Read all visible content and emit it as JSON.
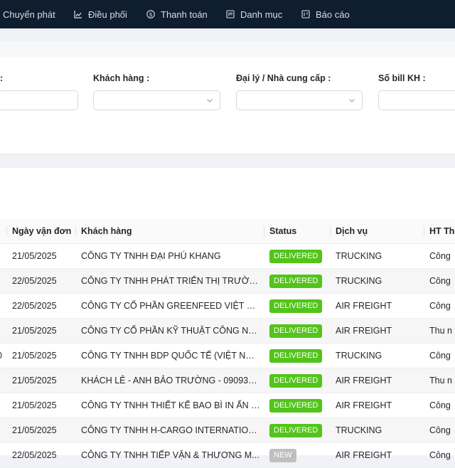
{
  "colors": {
    "topbar": "#0f1e2e",
    "delivered": "#52c41a",
    "new": "#bfbfbf"
  },
  "nav": {
    "items": [
      {
        "label": "Chuyển phát",
        "icon": "none"
      },
      {
        "label": "Điều phối",
        "icon": "chart-icon"
      },
      {
        "label": "Thanh toán",
        "icon": "dollar-circle-icon"
      },
      {
        "label": "Danh mục",
        "icon": "catalog-icon"
      },
      {
        "label": "Báo cáo",
        "icon": "report-icon"
      }
    ]
  },
  "filters": {
    "first_label_suffix": ":",
    "customer_label": "Khách hàng :",
    "agent_label": "Đại lý / Nhà cung cấp :",
    "bill_label": "Số bill KH :"
  },
  "table": {
    "columns": [
      "Ngày vận đơn",
      "Khách hàng",
      "Status",
      "Dịch vụ",
      "HT Th"
    ],
    "rows": [
      {
        "lead": "",
        "date": "21/05/2025",
        "customer": "CÔNG TY TNHH ĐẠI PHÚ KHANG",
        "status": "DELIVERED",
        "service": "TRUCKING",
        "ht": "Công"
      },
      {
        "lead": "",
        "date": "22/05/2025",
        "customer": "CÔNG TY TNHH PHÁT TRIỂN THỊ TRƯỜN...",
        "status": "DELIVERED",
        "service": "TRUCKING",
        "ht": "Công"
      },
      {
        "lead": "",
        "date": "22/05/2025",
        "customer": "CÔNG TY CỔ PHẦN GREENFEED VIỆT NAM",
        "status": "DELIVERED",
        "service": "AIR FREIGHT",
        "ht": "Công"
      },
      {
        "lead": "",
        "date": "21/05/2025",
        "customer": "CÔNG TY CỔ PHẦN KỸ THUẬT CÔNG NG...",
        "status": "DELIVERED",
        "service": "AIR FREIGHT",
        "ht": "Thu n"
      },
      {
        "lead": "0",
        "date": "21/05/2025",
        "customer": "CÔNG TY TNHH BDP QUỐC TẾ (VIỆT NAM)",
        "status": "DELIVERED",
        "service": "TRUCKING",
        "ht": "Công"
      },
      {
        "lead": "",
        "date": "21/05/2025",
        "customer": "KHÁCH LẺ - ANH BẢO TRƯỜNG - 090932...",
        "status": "DELIVERED",
        "service": "AIR FREIGHT",
        "ht": "Thu n"
      },
      {
        "lead": "",
        "date": "21/05/2025",
        "customer": "CÔNG TY TNHH THIẾT KẾ BAO BÌ IN ẤN B...",
        "status": "DELIVERED",
        "service": "AIR FREIGHT",
        "ht": "Công"
      },
      {
        "lead": "",
        "date": "21/05/2025",
        "customer": "CÔNG TY TNHH H-CARGO INTERNATION...",
        "status": "DELIVERED",
        "service": "TRUCKING",
        "ht": "Công"
      },
      {
        "lead": "",
        "date": "22/05/2025",
        "customer": "CÔNG TY TNHH TIẾP VẬN & THƯƠNG M...",
        "status": "NEW",
        "service": "AIR FREIGHT",
        "ht": "Công"
      }
    ]
  }
}
